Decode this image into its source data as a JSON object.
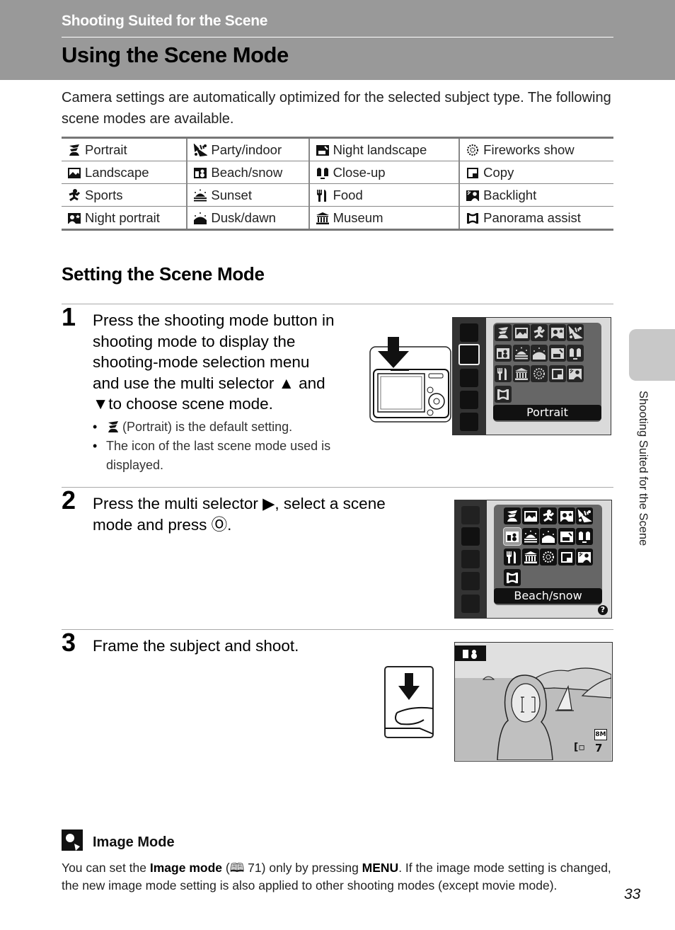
{
  "header": {
    "section": "Shooting Suited for the Scene",
    "title": "Using the Scene Mode"
  },
  "intro": "Camera settings are automatically optimized for the selected subject type. The following scene modes are available.",
  "scene_table": {
    "rows": [
      [
        {
          "icon": "portrait-icon",
          "label": "Portrait"
        },
        {
          "icon": "party-indoor-icon",
          "label": "Party/indoor"
        },
        {
          "icon": "night-landscape-icon",
          "label": "Night landscape"
        },
        {
          "icon": "fireworks-show-icon",
          "label": "Fireworks show"
        }
      ],
      [
        {
          "icon": "landscape-icon",
          "label": "Landscape"
        },
        {
          "icon": "beach-snow-icon",
          "label": "Beach/snow"
        },
        {
          "icon": "close-up-icon",
          "label": "Close-up"
        },
        {
          "icon": "copy-icon",
          "label": "Copy"
        }
      ],
      [
        {
          "icon": "sports-icon",
          "label": "Sports"
        },
        {
          "icon": "sunset-icon",
          "label": "Sunset"
        },
        {
          "icon": "food-icon",
          "label": "Food"
        },
        {
          "icon": "backlight-icon",
          "label": "Backlight"
        }
      ],
      [
        {
          "icon": "night-portrait-icon",
          "label": "Night portrait"
        },
        {
          "icon": "dusk-dawn-icon",
          "label": "Dusk/dawn"
        },
        {
          "icon": "museum-icon",
          "label": "Museum"
        },
        {
          "icon": "panorama-assist-icon",
          "label": "Panorama assist"
        }
      ]
    ]
  },
  "subheading": "Setting the Scene Mode",
  "steps": [
    {
      "number": "1",
      "text_lines": [
        "Press the shooting mode button in",
        "shooting mode to display the",
        "shooting-mode selection menu",
        "and use the multi selector ▲ and",
        "▼to choose scene mode."
      ],
      "bullets": [
        "(Portrait) is the default setting.",
        "The icon of the last scene mode used is displayed."
      ],
      "screen_label": "Portrait"
    },
    {
      "number": "2",
      "text_lines": [
        "Press the multi selector ▶, select a scene",
        "mode and press Ⓞ."
      ],
      "ok_symbol": "OK",
      "screen_label": "Beach/snow",
      "help_symbol": "?"
    },
    {
      "number": "3",
      "text_lines": [
        "Frame the subject and shoot."
      ],
      "image_size": "8M",
      "remaining_shots": "7"
    }
  ],
  "note": {
    "title": "Image Mode",
    "text_pre": "You can set the ",
    "bold": "Image mode",
    "text_ref": " (🕮 71) only by pressing ",
    "menu": "MENU",
    "text_post": ". If the image mode setting is changed, the new image mode setting is also applied to other shooting modes (except movie mode)."
  },
  "side_tab": "Shooting Suited for the Scene",
  "page_number": "33"
}
